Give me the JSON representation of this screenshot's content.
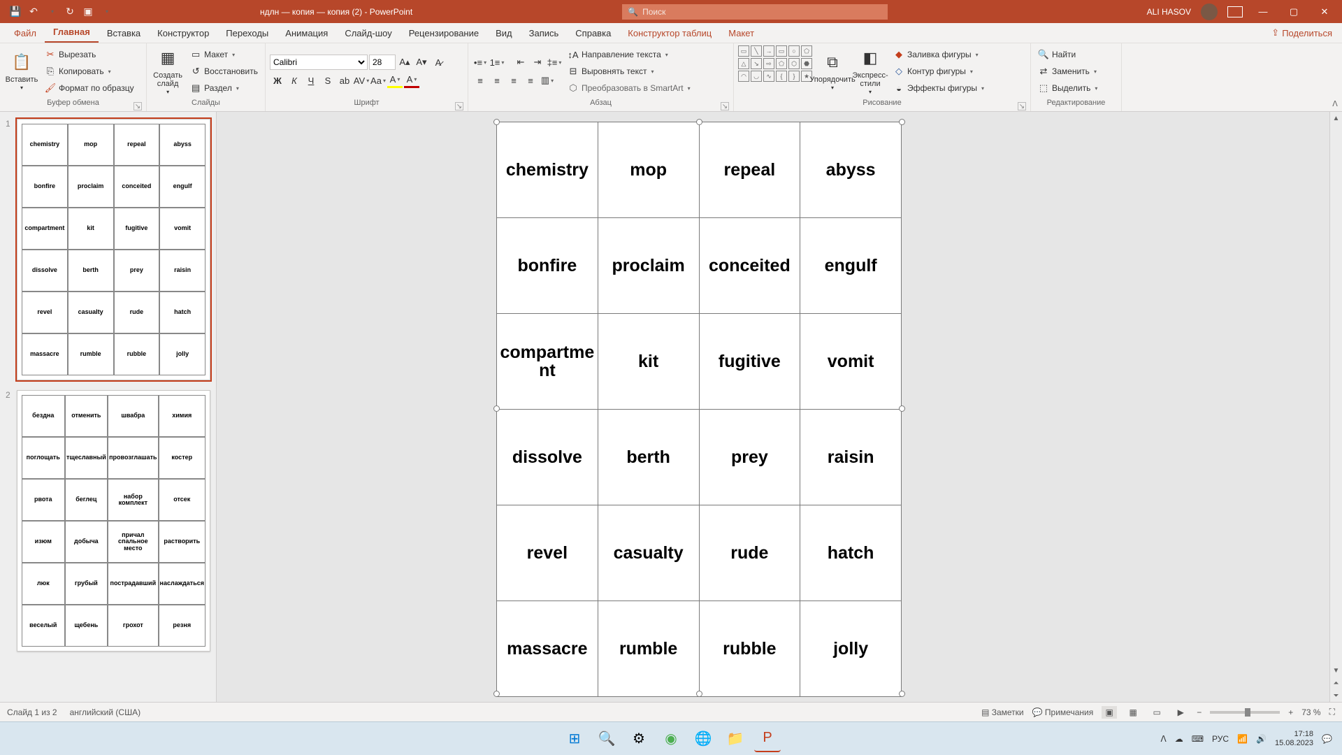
{
  "title": {
    "doc": "ндлн — копия — копия (2)",
    "app": "PowerPoint",
    "search": "Поиск",
    "user": "ALI HASOV"
  },
  "tabs": {
    "file": "Файл",
    "home": "Главная",
    "insert": "Вставка",
    "design": "Конструктор",
    "trans": "Переходы",
    "anim": "Анимация",
    "show": "Слайд-шоу",
    "review": "Рецензирование",
    "view": "Вид",
    "record": "Запись",
    "help": "Справка",
    "tbl": "Конструктор таблиц",
    "layout": "Макет",
    "share": "Поделиться"
  },
  "ribbon": {
    "paste": "Вставить",
    "cut": "Вырезать",
    "copy": "Копировать",
    "painter": "Формат по образцу",
    "clip": "Буфер обмена",
    "newslide": "Создать слайд",
    "layoutbtn": "Макет",
    "reset": "Восстановить",
    "section": "Раздел",
    "slides": "Слайды",
    "font": "Шрифт",
    "fontname": "Calibri",
    "fontsize": "28",
    "para": "Абзац",
    "textdir": "Направление текста",
    "align": "Выровнять текст",
    "smart": "Преобразовать в SmartArt",
    "draw": "Рисование",
    "arrange": "Упорядочить",
    "quick": "Экспресс-стили",
    "fill": "Заливка фигуры",
    "outline": "Контур фигуры",
    "effects": "Эффекты фигуры",
    "edit": "Редактирование",
    "find": "Найти",
    "replace": "Заменить",
    "select": "Выделить"
  },
  "slide1": [
    [
      "chemistry",
      "mop",
      "repeal",
      "abyss"
    ],
    [
      "bonfire",
      "proclaim",
      "conceited",
      "engulf"
    ],
    [
      "compartment",
      "kit",
      "fugitive",
      "vomit"
    ],
    [
      "dissolve",
      "berth",
      "prey",
      "raisin"
    ],
    [
      "revel",
      "casualty",
      "rude",
      "hatch"
    ],
    [
      "massacre",
      "rumble",
      "rubble",
      "jolly"
    ]
  ],
  "slide2": [
    [
      "бездна",
      "отменить",
      "швабра",
      "химия"
    ],
    [
      "поглощать",
      "тщеславный",
      "провозглашать",
      "костер"
    ],
    [
      "рвота",
      "беглец",
      "набор комплект",
      "отсек"
    ],
    [
      "изюм",
      "добыча",
      "причал спальное место",
      "растворить"
    ],
    [
      "люк",
      "грубый",
      "пострадавший",
      "наслаждаться"
    ],
    [
      "веселый",
      "щебень",
      "грохот",
      "резня"
    ]
  ],
  "status": {
    "slide": "Слайд 1 из 2",
    "lang": "английский (США)",
    "notes": "Заметки",
    "comments": "Примечания",
    "zoom": "73 %"
  },
  "tray": {
    "ime": "РУС",
    "time": "17:18",
    "date": "15.08.2023"
  }
}
